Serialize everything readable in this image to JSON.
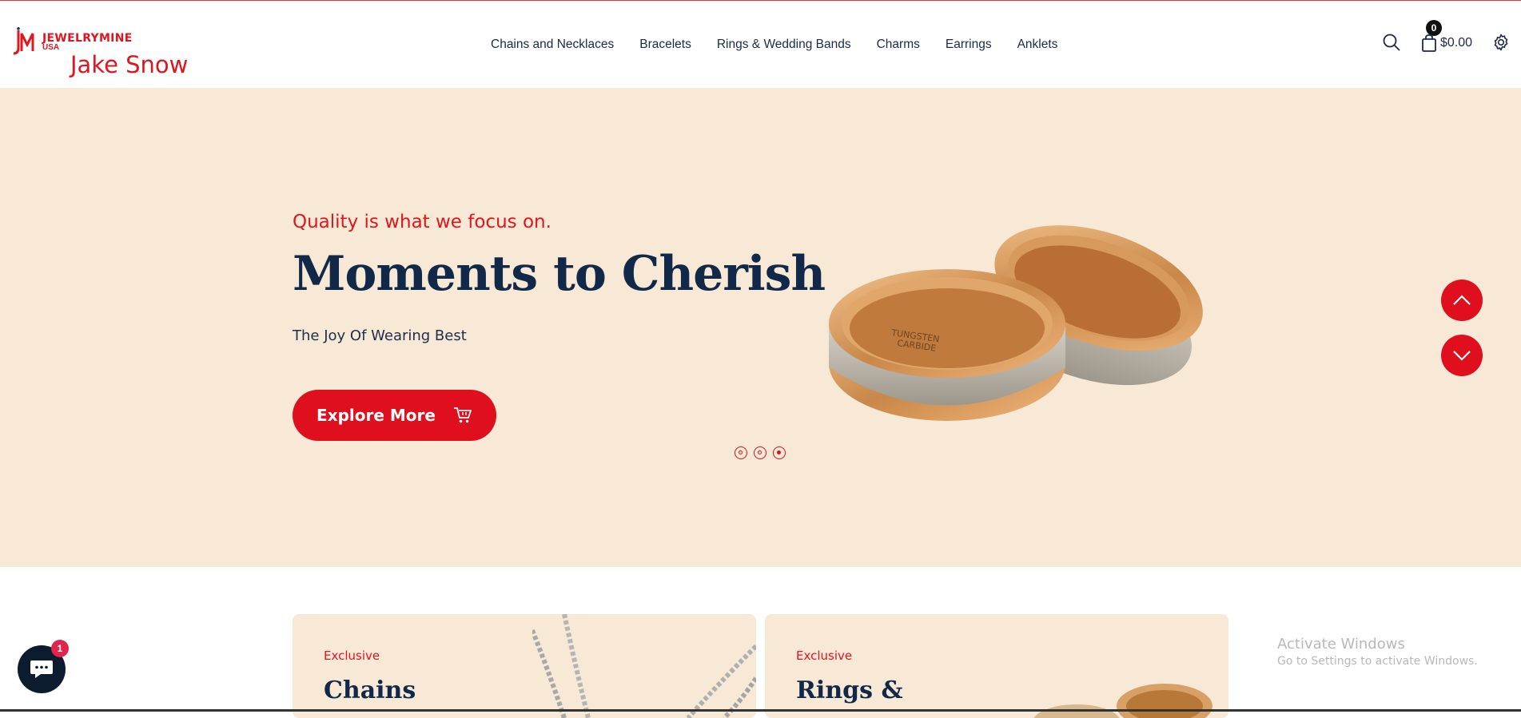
{
  "header": {
    "brand": {
      "word": "JEWELRYMINE",
      "sub": "USA",
      "name": "Jake Snow",
      "mark_icon": "jm-logo-icon"
    },
    "nav": [
      {
        "label": "Chains and Necklaces"
      },
      {
        "label": "Bracelets"
      },
      {
        "label": "Rings & Wedding Bands"
      },
      {
        "label": "Charms"
      },
      {
        "label": "Earrings"
      },
      {
        "label": "Anklets"
      }
    ],
    "search_icon": "search-icon",
    "cart": {
      "count": "0",
      "total": "$0.00",
      "icon": "shopping-bag-icon"
    },
    "settings_icon": "gear-icon"
  },
  "hero": {
    "kicker": "Quality is what we focus on.",
    "title": "Moments to Cherish",
    "subtitle": "The Joy Of Wearing Best",
    "button_label": "Explore More",
    "button_icon": "cart-icon",
    "slides_total": 3,
    "active_slide": 3
  },
  "cards": [
    {
      "kicker": "Exclusive",
      "title": "Chains"
    },
    {
      "kicker": "Exclusive",
      "title": "Rings &"
    }
  ],
  "chat": {
    "badge": "1",
    "icon": "chat-bubble-icon"
  },
  "os_overlay": {
    "line1": "Activate Windows",
    "line2": "Go to Settings to activate Windows."
  },
  "colors": {
    "accent_red": "#df0f1e",
    "navy": "#112848",
    "hero_bg": "#f8e9d6",
    "chat_bg": "#0c1b2e"
  }
}
